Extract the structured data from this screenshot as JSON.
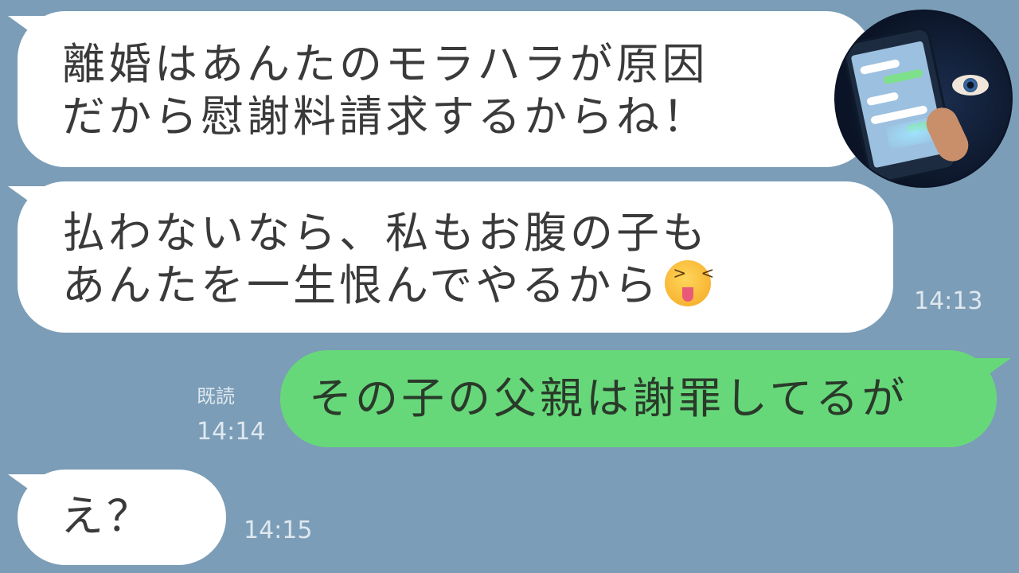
{
  "messages": [
    {
      "side": "left",
      "lines": [
        "離婚はあんたのモラハラが原因",
        "だから慰謝料請求するからね！"
      ]
    },
    {
      "side": "left",
      "lines": [
        "払わないなら、私もお腹の子も",
        "あんたを一生恨んでやるから"
      ],
      "emoji": "squinting-tongue-emoji",
      "time": "14:13"
    },
    {
      "side": "right",
      "lines": [
        "その子の父親は謝罪してるが"
      ],
      "read": "既読",
      "time": "14:14"
    },
    {
      "side": "left",
      "lines": [
        "え？"
      ],
      "time": "14:15"
    }
  ],
  "colors": {
    "background": "#7b9db7",
    "incoming_bubble": "#ffffff",
    "outgoing_bubble": "#67d87a"
  },
  "avatar": {
    "icon": "hooded-figure-phone-icon"
  }
}
